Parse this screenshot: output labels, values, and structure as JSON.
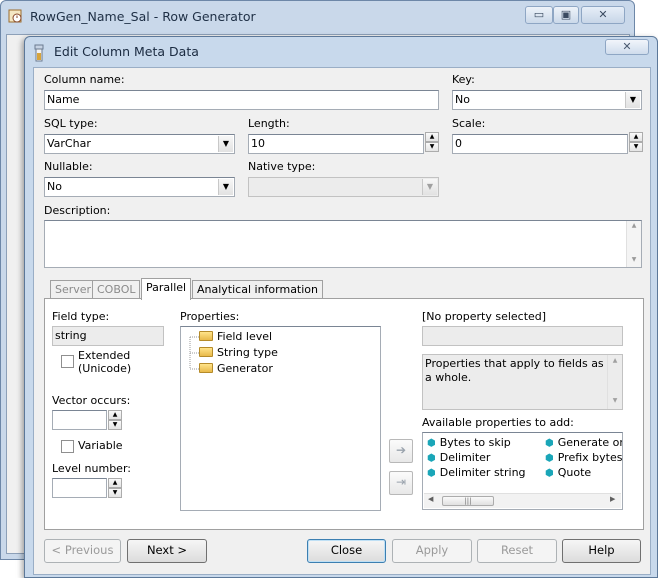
{
  "background_window": {
    "title": "RowGen_Name_Sal - Row Generator",
    "minimize_glyph": "▭",
    "maximize_glyph": "▣",
    "close_glyph": "✕"
  },
  "dialog": {
    "title": "Edit Column Meta Data",
    "close_glyph": "✕"
  },
  "form": {
    "column_name_label": "Column name:",
    "column_name_value": "Name",
    "key_label": "Key:",
    "key_value": "No",
    "sql_type_label": "SQL type:",
    "sql_type_value": "VarChar",
    "length_label": "Length:",
    "length_value": "10",
    "scale_label": "Scale:",
    "scale_value": "0",
    "nullable_label": "Nullable:",
    "nullable_value": "No",
    "native_type_label": "Native type:",
    "native_type_value": "",
    "description_label": "Description:",
    "description_value": ""
  },
  "tabs": [
    {
      "label": "Server",
      "state": "disabled"
    },
    {
      "label": "COBOL",
      "state": "disabled"
    },
    {
      "label": "Parallel",
      "state": "active"
    },
    {
      "label": "Analytical information",
      "state": "normal"
    }
  ],
  "parallel": {
    "field_type_label": "Field type:",
    "field_type_value": "string",
    "extended_label_1": "Extended",
    "extended_label_2": "(Unicode)",
    "extended_checked": false,
    "vector_occurs_label": "Vector occurs:",
    "vector_occurs_value": "",
    "variable_label": "Variable",
    "variable_checked": false,
    "level_number_label": "Level number:",
    "level_number_value": "",
    "properties_label": "Properties:",
    "properties_tree": [
      "Field level",
      "String type",
      "Generator"
    ],
    "no_property_selected": "[No property selected]",
    "property_value": "",
    "property_help": "Properties that apply to fields as a whole.",
    "available_label": "Available properties to add:",
    "available_col1": [
      "Bytes to skip",
      "Delimiter",
      "Delimiter string"
    ],
    "available_col2": [
      "Generate on c",
      "Prefix bytes",
      "Quote"
    ],
    "add_arrow_glyph": "➔",
    "add_end_glyph": "⇥"
  },
  "buttons": {
    "previous": "< Previous",
    "next": "Next >",
    "close": "Close",
    "apply": "Apply",
    "reset": "Reset",
    "help": "Help"
  },
  "colors": {
    "window_frame": "#c8d9ec",
    "dialog_bg": "#f0f0f0",
    "icon_teal": "#1aa6b8",
    "folder_yellow": "#ffe48a"
  }
}
